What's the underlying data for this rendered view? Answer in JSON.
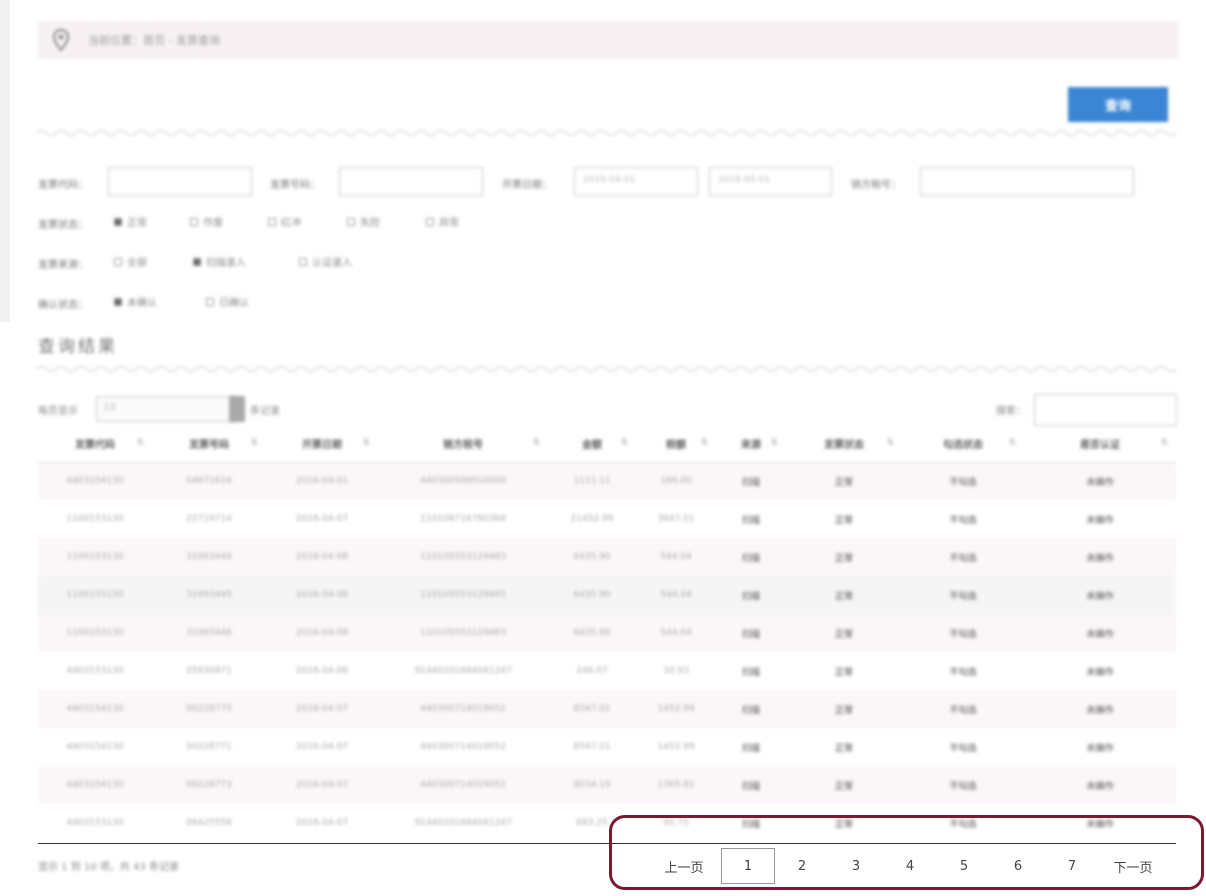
{
  "breadcrumb": {
    "text": "当前位置：首页 - 发票查询"
  },
  "buttons": {
    "query": "查询"
  },
  "filters": {
    "invoice_code_label": "发票代码：",
    "invoice_no_label": "发票号码：",
    "date_label": "开票日期：",
    "date_from": "2016-04-01",
    "date_to": "2016-05-01",
    "seller_tax_label": "销方税号：",
    "status_label": "发票状态：",
    "status_options": [
      "正常",
      "作废",
      "红冲",
      "失控",
      "异常"
    ],
    "source_label": "发票来源：",
    "source_options": [
      "全部",
      "扫描录入",
      "认证录入"
    ],
    "confirm_label": "确认状态：",
    "confirm_options": [
      "未确认",
      "已确认"
    ]
  },
  "results": {
    "title": "查询结果",
    "per_page_label": "每页显示",
    "per_page_value": "10",
    "per_page_suffix": "条记录",
    "search_label": "搜索："
  },
  "table": {
    "columns": [
      "发票代码",
      "发票号码",
      "开票日期",
      "销方税号",
      "金额",
      "税额",
      "来源",
      "发票状态",
      "勾选状态",
      "是否认证"
    ],
    "rows": [
      [
        "4403154130",
        "04671616",
        "2016-04-01",
        "440300599010000",
        "1111.11",
        "166.00",
        "扫描",
        "正常",
        "不勾选",
        "未操作"
      ],
      [
        "1100153130",
        "22719714",
        "2016-04-07",
        "110108716780368",
        "21452.99",
        "3647.01",
        "扫描",
        "正常",
        "不勾选",
        "未操作"
      ],
      [
        "1100153130",
        "31993444",
        "2016-04-08",
        "110105553129483",
        "6435.90",
        "544.04",
        "扫描",
        "正常",
        "不勾选",
        "未操作"
      ],
      [
        "1100153130",
        "31993445",
        "2016-04-08",
        "110105553129483",
        "6435.90",
        "544.04",
        "扫描",
        "正常",
        "不勾选",
        "未操作"
      ],
      [
        "1100153130",
        "31993446",
        "2016-04-08",
        "110105553129483",
        "6435.90",
        "544.04",
        "扫描",
        "正常",
        "不勾选",
        "未操作"
      ],
      [
        "4403153130",
        "05930971",
        "2016-04-08",
        "91440101684041247",
        "246.07",
        "30.93",
        "扫描",
        "正常",
        "不勾选",
        "未操作"
      ],
      [
        "4403154130",
        "00228775",
        "2016-04-07",
        "440300714019052",
        "8547.01",
        "1452.99",
        "扫描",
        "正常",
        "不勾选",
        "未操作"
      ],
      [
        "4403154130",
        "00228771",
        "2016-04-07",
        "440300714019052",
        "8547.01",
        "1452.99",
        "扫描",
        "正常",
        "不勾选",
        "未操作"
      ],
      [
        "4403154130",
        "00228773",
        "2016-04-07",
        "440300714019052",
        "8034.19",
        "1365.81",
        "扫描",
        "正常",
        "不勾选",
        "未操作"
      ],
      [
        "4403153130",
        "06425556",
        "2016-04-07",
        "91440101684041247",
        "683.25",
        "95.75",
        "扫描",
        "正常",
        "不勾选",
        "未操作"
      ]
    ]
  },
  "summary": "显示 1 到 10 项，共 43 条记录",
  "pagination": {
    "prev": "上一页",
    "pages": [
      "1",
      "2",
      "3",
      "4",
      "5",
      "6",
      "7"
    ],
    "active": "1",
    "next": "下一页"
  },
  "colors": {
    "accent": "#3a86d4",
    "annotation": "#7a1a2e",
    "row_tint": "#fbf6f8"
  }
}
